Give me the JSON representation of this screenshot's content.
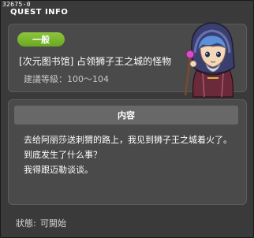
{
  "window": {
    "id_line": "32675-0",
    "title": "QUEST INFO"
  },
  "quest": {
    "category_badge": "一般",
    "name": "[次元图书馆] 占领狮子王之城的怪物",
    "level_label": "建議等级",
    "level_range": "100～104",
    "level_line": "建議等級：100～104"
  },
  "content": {
    "header": "内容",
    "lines": [
      "去给阿丽莎送刺猬的路上，我见到狮子王之城着火了。",
      "到底发生了什么事？",
      "我得跟迈勒谈谈。"
    ]
  },
  "status": {
    "label": "狀態",
    "value": "可開始"
  },
  "colors": {
    "badge": "#7ab82f",
    "panel": "#4a4a4a",
    "window": "#3a3a3a",
    "header_bar": "#686868"
  },
  "icons": {
    "npc": "npc-portrait-icon"
  }
}
